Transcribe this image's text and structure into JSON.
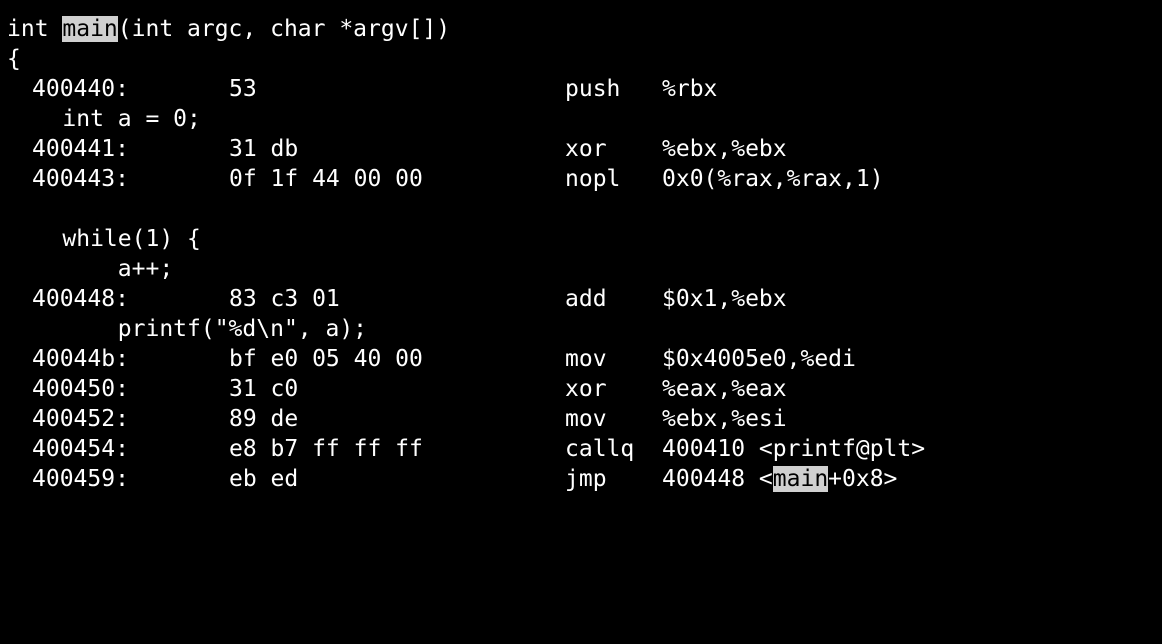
{
  "colors": {
    "background": "#000000",
    "text": "#ffffff",
    "highlight_background": "#d0d0d0",
    "highlight_text": "#000000"
  },
  "search_highlight": "main",
  "lines": {
    "sig": {
      "before": "int ",
      "hl": "main",
      "after": "(int argc, char *argv[])"
    },
    "brace": "{",
    "decl": "    int a = 0;",
    "while": "    while(1) {",
    "inc": "        a++;",
    "printf_src": "        printf(\"%d\\n\", a);"
  },
  "asm": [
    {
      "addr": "400440:",
      "bytes": "53",
      "mnemonic": "push",
      "operands": "%rbx"
    },
    {
      "addr": "400441:",
      "bytes": "31 db",
      "mnemonic": "xor",
      "operands": "%ebx,%ebx"
    },
    {
      "addr": "400443:",
      "bytes": "0f 1f 44 00 00",
      "mnemonic": "nopl",
      "operands": "0x0(%rax,%rax,1)"
    },
    {
      "addr": "400448:",
      "bytes": "83 c3 01",
      "mnemonic": "add",
      "operands": "$0x1,%ebx"
    },
    {
      "addr": "40044b:",
      "bytes": "bf e0 05 40 00",
      "mnemonic": "mov",
      "operands": "$0x4005e0,%edi"
    },
    {
      "addr": "400450:",
      "bytes": "31 c0",
      "mnemonic": "xor",
      "operands": "%eax,%eax"
    },
    {
      "addr": "400452:",
      "bytes": "89 de",
      "mnemonic": "mov",
      "operands": "%ebx,%esi"
    },
    {
      "addr": "400454:",
      "bytes": "e8 b7 ff ff ff",
      "mnemonic": "callq",
      "operands": "400410 <printf@plt>"
    },
    {
      "addr": "400459:",
      "bytes": "eb ed",
      "mnemonic": "jmp",
      "operands_before": "400448 <",
      "operands_hl": "main",
      "operands_after": "+0x8>"
    }
  ]
}
